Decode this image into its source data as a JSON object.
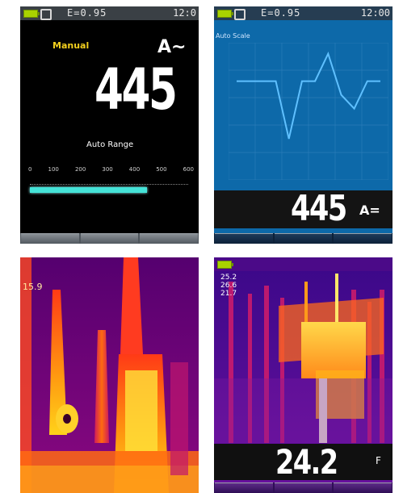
{
  "panel1": {
    "status": {
      "e_text": "E=0.95",
      "time": "12:0"
    },
    "mode_label": "Manual",
    "unit": "A~",
    "value": "445",
    "range_label": "Auto Range",
    "scale_ticks": [
      "0",
      "100",
      "200",
      "300",
      "400",
      "500",
      "600"
    ],
    "bar_fraction": 0.74,
    "softkeys": [
      "",
      "",
      ""
    ],
    "colors": {
      "bar": "#45e3d8",
      "mode": "#f2cf1e"
    }
  },
  "panel2": {
    "status": {
      "e_text": "E=0.95",
      "time": "12:00"
    },
    "chart_title": "Auto Scale",
    "value": "445",
    "unit": "A=",
    "softkeys": [
      "",
      "",
      ""
    ],
    "chart_data": {
      "type": "line",
      "title": "",
      "x": [
        0,
        1,
        2,
        3,
        4,
        5,
        6,
        7,
        8,
        9,
        10,
        11
      ],
      "series": [
        {
          "values": [
            0.72,
            0.72,
            0.72,
            0.72,
            0.3,
            0.72,
            0.72,
            0.92,
            0.62,
            0.52,
            0.72,
            0.72
          ]
        }
      ],
      "grid": true,
      "colors": {
        "line": "#5fc0ff",
        "grid": "#2a7cb9"
      }
    }
  },
  "panel3": {
    "corner_temp": "15.9"
  },
  "panel4": {
    "temp_values": [
      "25.2",
      "26.6",
      "21.7"
    ],
    "value": "24.2",
    "unit": "F"
  }
}
